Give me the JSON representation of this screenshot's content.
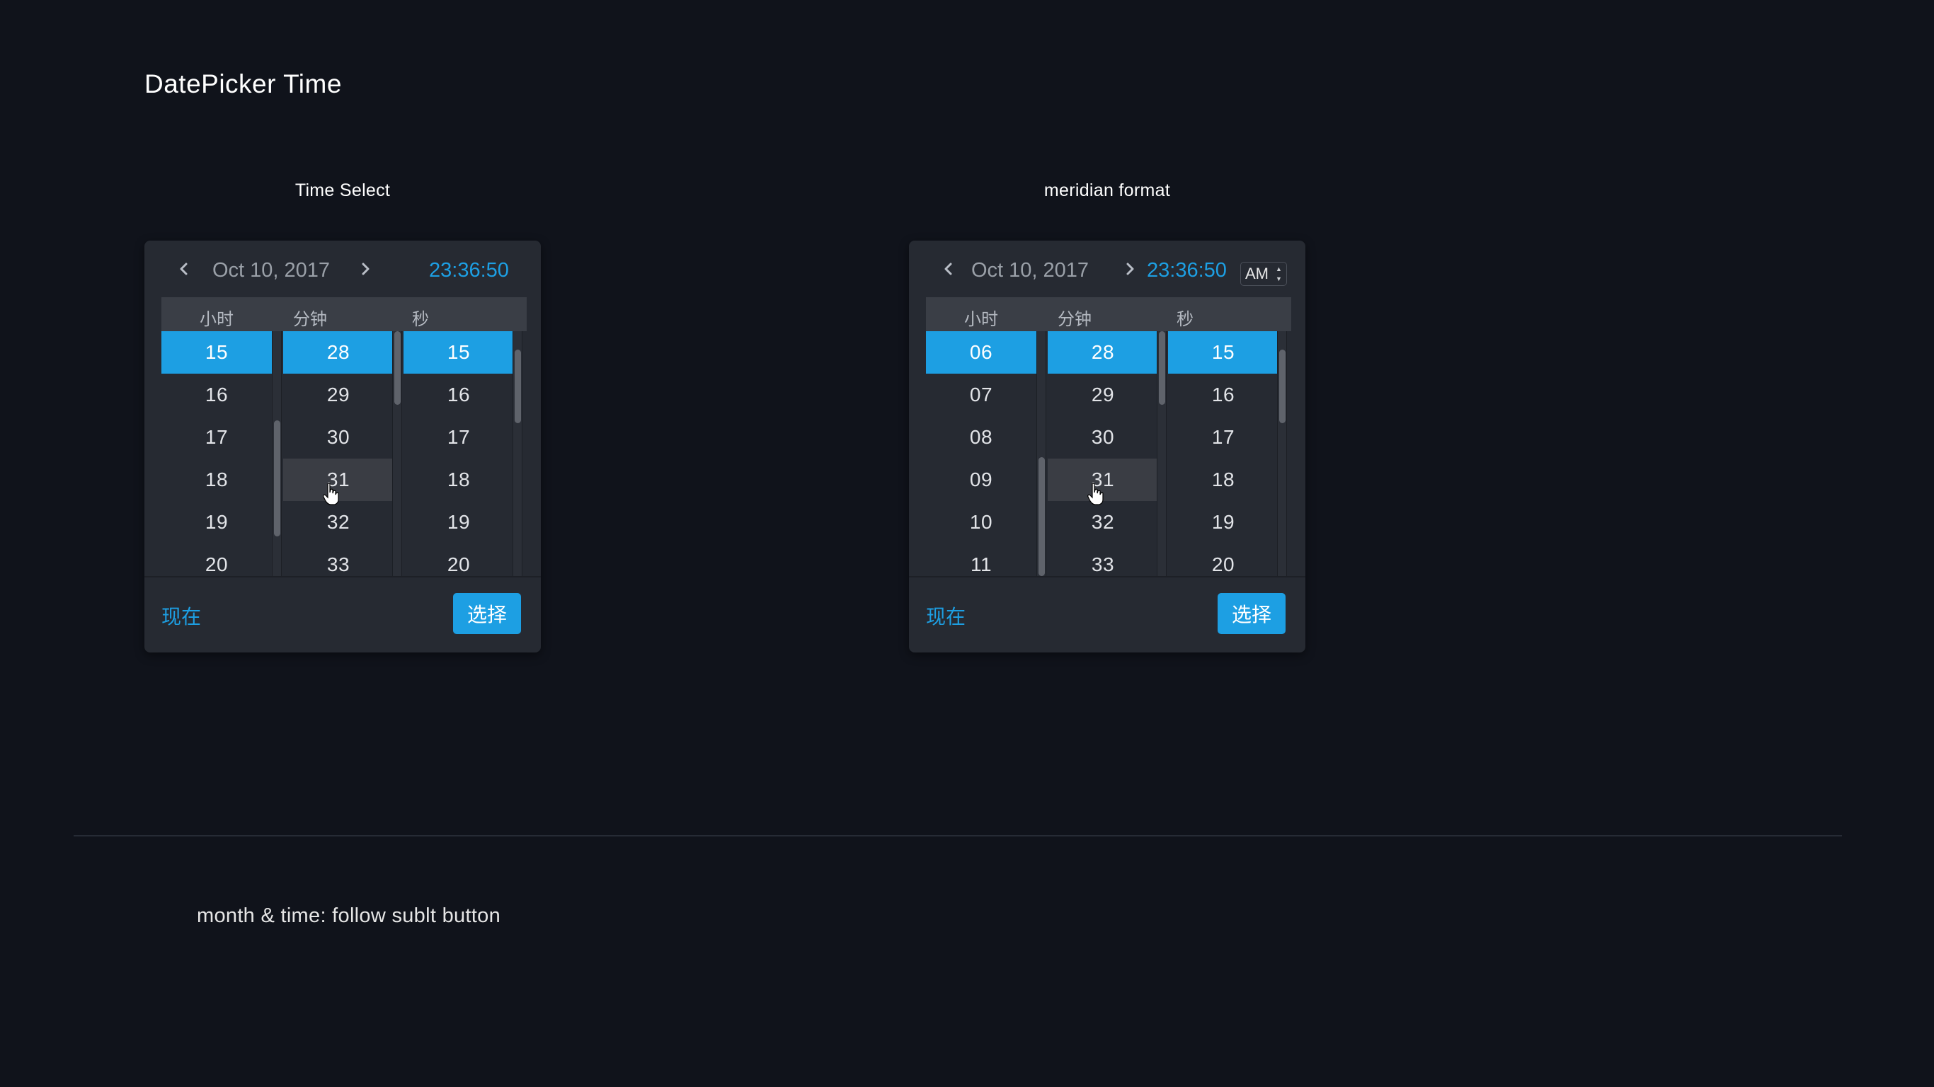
{
  "page_title": "DatePicker Time",
  "note": "month & time: follow sublt button",
  "pickers": [
    {
      "section_label": "Time Select",
      "date": "Oct 10, 2017",
      "time": "23:36:50",
      "ampm": null,
      "columns": [
        {
          "title": "小时",
          "values": [
            "15",
            "16",
            "17",
            "18",
            "19",
            "20"
          ],
          "selected_index": 0
        },
        {
          "title": "分钟",
          "values": [
            "28",
            "29",
            "30",
            "31",
            "32",
            "33"
          ],
          "selected_index": 0,
          "hover_index": 3
        },
        {
          "title": "秒",
          "values": [
            "15",
            "16",
            "17",
            "18",
            "19",
            "20"
          ],
          "selected_index": 0
        }
      ],
      "now_label": "现在",
      "select_label": "选择"
    },
    {
      "section_label": "meridian format",
      "date": "Oct 10, 2017",
      "time": "23:36:50",
      "ampm": "AM",
      "columns": [
        {
          "title": "小时",
          "values": [
            "06",
            "07",
            "08",
            "09",
            "10",
            "11"
          ],
          "selected_index": 0
        },
        {
          "title": "分钟",
          "values": [
            "28",
            "29",
            "30",
            "31",
            "32",
            "33"
          ],
          "selected_index": 0,
          "hover_index": 3
        },
        {
          "title": "秒",
          "values": [
            "15",
            "16",
            "17",
            "18",
            "19",
            "20"
          ],
          "selected_index": 0
        }
      ],
      "now_label": "现在",
      "select_label": "选择"
    }
  ],
  "colors": {
    "background": "#10131b",
    "panel": "#262a32",
    "accent": "#1d9fe3",
    "header": "#3a3e46"
  },
  "icons": [
    "chevron-left-icon",
    "chevron-right-icon",
    "pointer-cursor-icon",
    "updown-arrows-icon"
  ]
}
